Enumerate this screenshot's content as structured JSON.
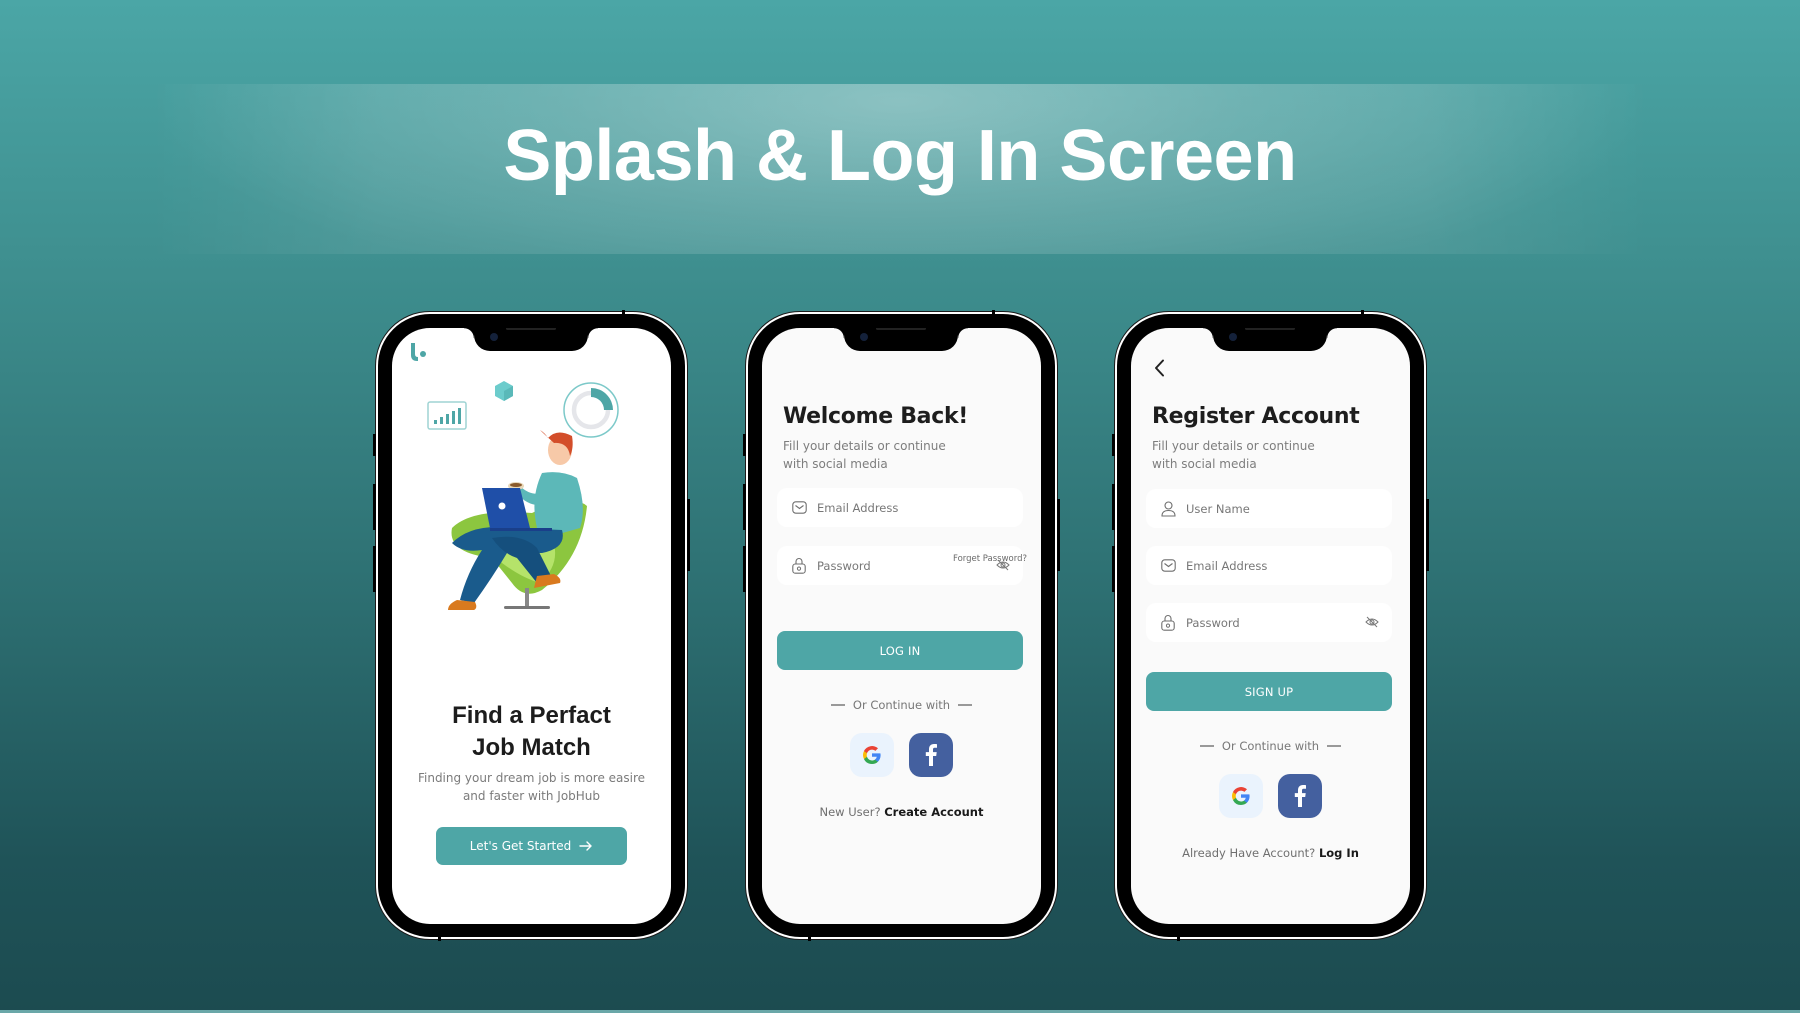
{
  "page": {
    "title": "Splash & Log In Screen",
    "colors": {
      "background_top": "#4ba6a6",
      "background_bottom": "#1c4b50",
      "accent": "#4ea6a6",
      "facebook": "#44609f",
      "google_bg": "#eaf3fd",
      "heading_text": "#1c1c1c",
      "muted_text": "#7b7b7b"
    }
  },
  "splash": {
    "logo_icon": "jobhub-logo-icon",
    "illustration": "man-with-laptop-in-chair-illustration",
    "heading_line1": "Find a Perfact",
    "heading_line2": "Job Match",
    "subtitle_line1": "Finding your dream job is more easire",
    "subtitle_line2": "and faster with JobHub",
    "cta_label": "Let's Get Started",
    "cta_icon": "arrow-right-icon"
  },
  "login": {
    "title": "Welcome Back!",
    "subtitle_line1": "Fill your details or continue",
    "subtitle_line2": "with social media",
    "email_placeholder": "Email Address",
    "password_placeholder": "Password",
    "forgot_password": "Forget Password?",
    "login_button": "LOG IN",
    "or_continue": "Or Continue with",
    "social": [
      "google",
      "facebook"
    ],
    "new_user_prompt": "New User?",
    "create_account_link": "Create Account"
  },
  "register": {
    "back_icon": "chevron-left-icon",
    "title": "Register Account",
    "subtitle_line1": "Fill your details or continue",
    "subtitle_line2": "with social media",
    "username_placeholder": "User Name",
    "email_placeholder": "Email Address",
    "password_placeholder": "Password",
    "signup_button": "SIGN UP",
    "or_continue": "Or Continue with",
    "social": [
      "google",
      "facebook"
    ],
    "existing_prompt": "Already Have Account?",
    "login_link": "Log In"
  }
}
